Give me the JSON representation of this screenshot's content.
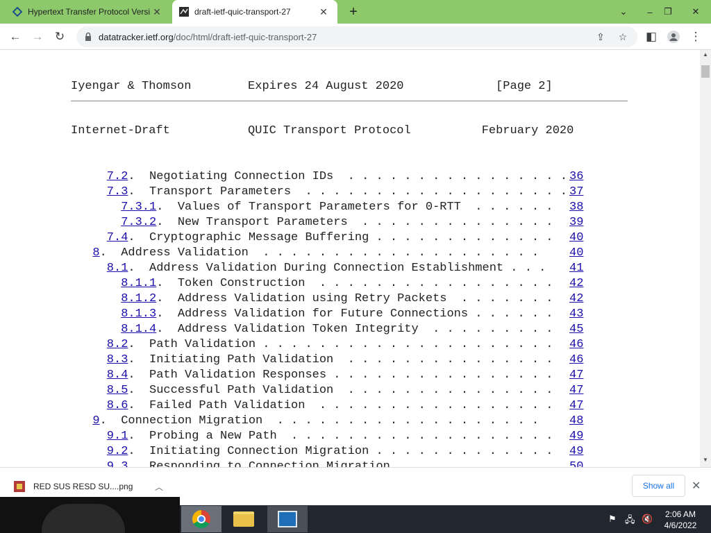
{
  "browser": {
    "tabs": [
      {
        "title": "Hypertext Transfer Protocol Versi",
        "favicon": "datatracker-favicon-icon",
        "active": false
      },
      {
        "title": "draft-ietf-quic-transport-27",
        "favicon": "ietf-favicon-icon",
        "active": true
      }
    ],
    "new_tab": "+",
    "url_host": "datatracker.ietf.org",
    "url_path": "/doc/html/draft-ietf-quic-transport-27"
  },
  "document": {
    "footer_line": "Iyengar & Thomson        Expires 24 August 2020             [Page 2]",
    "header_line": "Internet-Draft           QUIC Transport Protocol          February 2020",
    "toc": [
      {
        "indent": 2,
        "num": "7.2",
        "title": "Negotiating Connection IDs  . . . . . . . . . . . . . . . .",
        "page": "36"
      },
      {
        "indent": 2,
        "num": "7.3",
        "title": "Transport Parameters  . . . . . . . . . . . . . . . . . . .",
        "page": "37"
      },
      {
        "indent": 3,
        "num": "7.3.1",
        "title": "Values of Transport Parameters for 0-RTT  . . . . . .",
        "page": "38"
      },
      {
        "indent": 3,
        "num": "7.3.2",
        "title": "New Transport Parameters  . . . . . . . . . . . . . .",
        "page": "39"
      },
      {
        "indent": 2,
        "num": "7.4",
        "title": "Cryptographic Message Buffering . . . . . . . . . . . . .",
        "page": "40"
      },
      {
        "indent": 1,
        "num": "8",
        "title": "Address Validation  . . . . . . . . . . . . . . . . . . . .",
        "page": "40"
      },
      {
        "indent": 2,
        "num": "8.1",
        "title": "Address Validation During Connection Establishment . . .",
        "page": "41"
      },
      {
        "indent": 3,
        "num": "8.1.1",
        "title": "Token Construction  . . . . . . . . . . . . . . . . .",
        "page": "42"
      },
      {
        "indent": 3,
        "num": "8.1.2",
        "title": "Address Validation using Retry Packets  . . . . . . .",
        "page": "42"
      },
      {
        "indent": 3,
        "num": "8.1.3",
        "title": "Address Validation for Future Connections . . . . . .",
        "page": "43"
      },
      {
        "indent": 3,
        "num": "8.1.4",
        "title": "Address Validation Token Integrity  . . . . . . . . .",
        "page": "45"
      },
      {
        "indent": 2,
        "num": "8.2",
        "title": "Path Validation . . . . . . . . . . . . . . . . . . . . .",
        "page": "46"
      },
      {
        "indent": 2,
        "num": "8.3",
        "title": "Initiating Path Validation  . . . . . . . . . . . . . . .",
        "page": "46"
      },
      {
        "indent": 2,
        "num": "8.4",
        "title": "Path Validation Responses . . . . . . . . . . . . . . . .",
        "page": "47"
      },
      {
        "indent": 2,
        "num": "8.5",
        "title": "Successful Path Validation  . . . . . . . . . . . . . . .",
        "page": "47"
      },
      {
        "indent": 2,
        "num": "8.6",
        "title": "Failed Path Validation  . . . . . . . . . . . . . . . . .",
        "page": "47"
      },
      {
        "indent": 1,
        "num": "9",
        "title": "Connection Migration  . . . . . . . . . . . . . . . . . . .",
        "page": "48"
      },
      {
        "indent": 2,
        "num": "9.1",
        "title": "Probing a New Path  . . . . . . . . . . . . . . . . . . .",
        "page": "49"
      },
      {
        "indent": 2,
        "num": "9.2",
        "title": "Initiating Connection Migration . . . . . . . . . . . . .",
        "page": "49"
      },
      {
        "indent": 2,
        "num": "9.3",
        "title": "Responding to Connection Migration  . . . . . . . . . . .",
        "page": "50"
      }
    ]
  },
  "downloads": {
    "file_name": "RED SUS RESD SU....png",
    "show_all": "Show all"
  },
  "taskbar": {
    "time": "2:06 AM",
    "date": "4/6/2022"
  },
  "colors": {
    "tab_strip": "#8dc96a",
    "link": "#1a0dab",
    "taskbar": "#22262e"
  }
}
